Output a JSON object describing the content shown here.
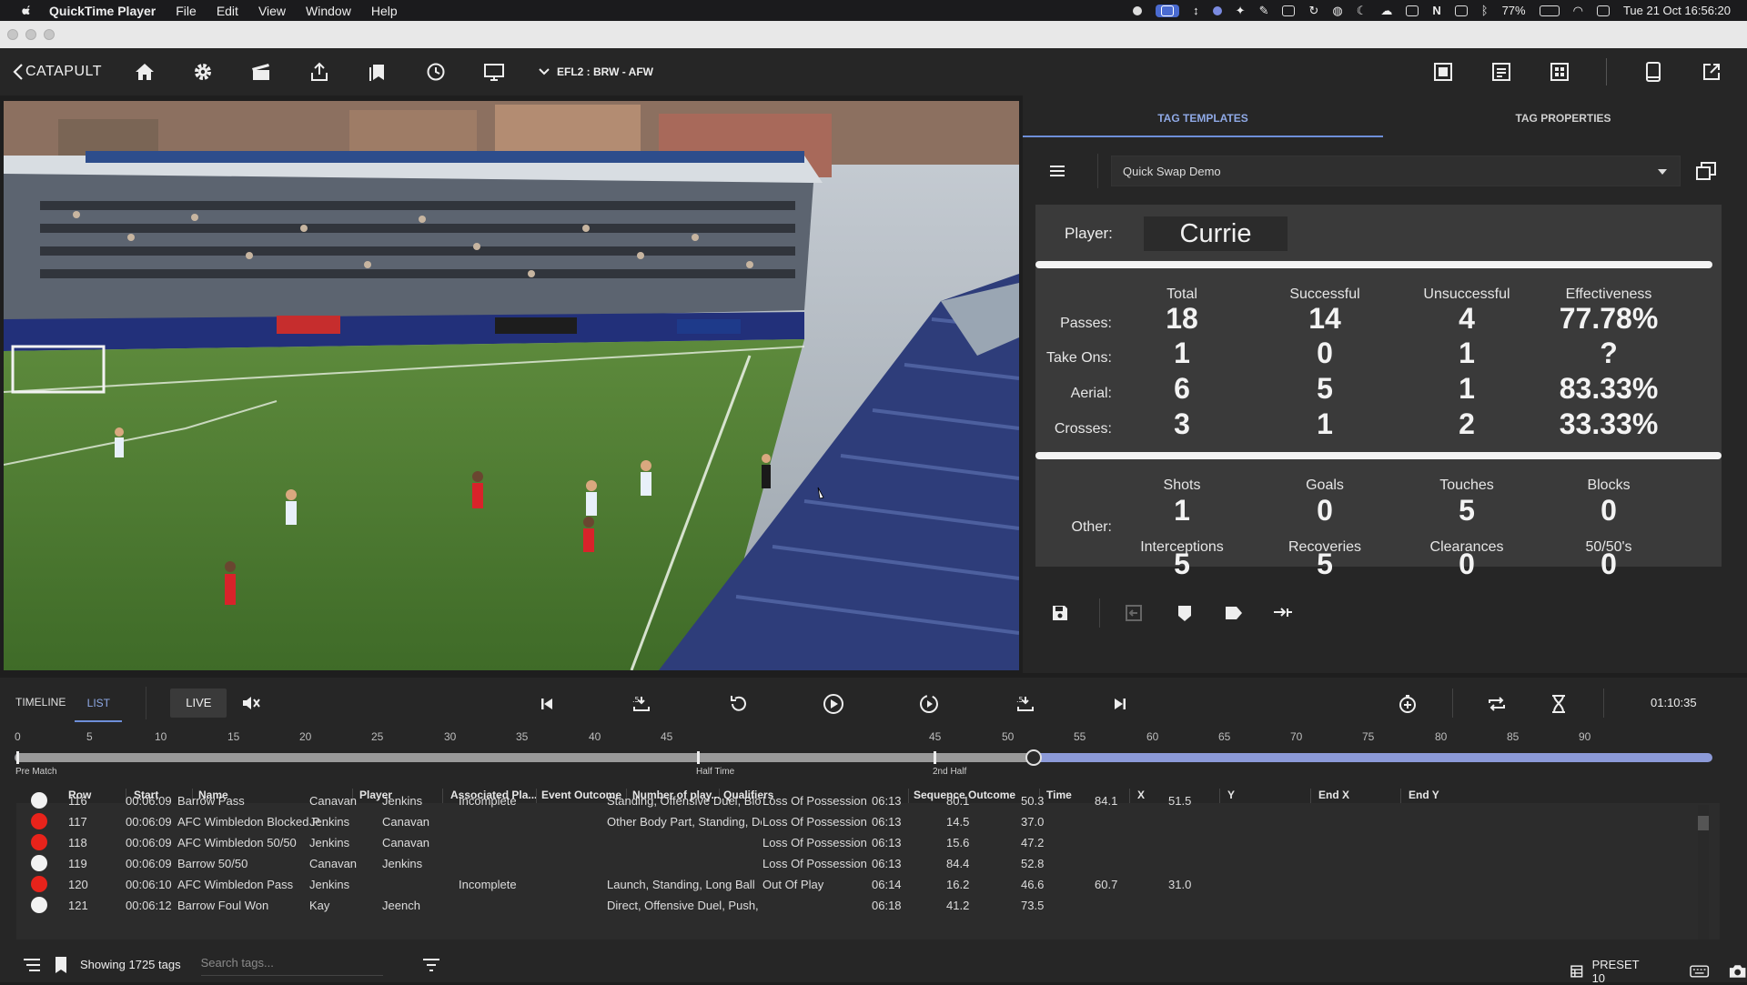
{
  "menubar": {
    "app_name": "QuickTime Player",
    "items": [
      "File",
      "Edit",
      "View",
      "Window",
      "Help"
    ],
    "battery": "77%",
    "datetime": "Tue 21 Oct  16:56:20"
  },
  "toolbar": {
    "brand": "CATAPULT",
    "match_label": "EFL2 : BRW - AFW"
  },
  "panel": {
    "tabs": [
      "TAG TEMPLATES",
      "TAG PROPERTIES"
    ],
    "active_tab": "TAG TEMPLATES",
    "template_value": "Quick Swap Demo",
    "player_label": "Player:",
    "player_name": "Currie",
    "stat_headers": [
      "Total",
      "Successful",
      "Unsuccessful",
      "Effectiveness"
    ],
    "stat_rows": [
      {
        "label": "Passes:",
        "total": "18",
        "successful": "14",
        "unsuccessful": "4",
        "effectiveness": "77.78%"
      },
      {
        "label": "Take Ons:",
        "total": "1",
        "successful": "0",
        "unsuccessful": "1",
        "effectiveness": "?"
      },
      {
        "label": "Aerial:",
        "total": "6",
        "successful": "5",
        "unsuccessful": "1",
        "effectiveness": "83.33%"
      },
      {
        "label": "Crosses:",
        "total": "3",
        "successful": "1",
        "unsuccessful": "2",
        "effectiveness": "33.33%"
      }
    ],
    "other_label": "Other:",
    "other_stats": [
      {
        "label": "Shots",
        "value": "1"
      },
      {
        "label": "Goals",
        "value": "0"
      },
      {
        "label": "Touches",
        "value": "5"
      },
      {
        "label": "Blocks",
        "value": "0"
      },
      {
        "label": "Interceptions",
        "value": "5"
      },
      {
        "label": "Recoveries",
        "value": "5"
      },
      {
        "label": "Clearances",
        "value": "0"
      },
      {
        "label": "50/50's",
        "value": "0"
      }
    ]
  },
  "controls": {
    "view_tabs": [
      "TIMELINE",
      "LIST"
    ],
    "active_view": "LIST",
    "live_label": "LIVE",
    "clock": "01:10:35"
  },
  "timeline": {
    "ticks_first_half": [
      "0",
      "5",
      "10",
      "15",
      "20",
      "25",
      "30",
      "35",
      "40",
      "45"
    ],
    "ticks_second_half": [
      "45",
      "50",
      "55",
      "60",
      "65",
      "70",
      "75",
      "80",
      "85",
      "90"
    ],
    "labels": [
      "Pre Match",
      "Half Time",
      "2nd Half"
    ],
    "progress_fraction": 0.6
  },
  "table": {
    "columns": [
      "Row",
      "Start",
      "Name",
      "Player",
      "Associated Pla...",
      "Event Outcome",
      "Number of play...",
      "Qualifiers",
      "Sequence Outcome",
      "Time",
      "X",
      "Y",
      "End X",
      "End Y"
    ],
    "rows": [
      {
        "color": "#f2f2f2",
        "cells": [
          "116",
          "00:06:09",
          "Barrow Pass",
          "Canavan",
          "Jenkins",
          "Incomplete",
          "",
          "Standing, Offensive Duel, Blocke...",
          "Loss Of Possession",
          "06:13",
          "80.1",
          "50.3",
          "84.1",
          "51.5"
        ]
      },
      {
        "color": "#e8231b",
        "cells": [
          "117",
          "00:06:09",
          "AFC Wimbledon Blocked P...",
          "Jenkins",
          "Canavan",
          "",
          "",
          "Other Body Part, Standing, Defen...",
          "Loss Of Possession",
          "06:13",
          "14.5",
          "37.0",
          "",
          ""
        ]
      },
      {
        "color": "#e8231b",
        "cells": [
          "118",
          "00:06:09",
          "AFC Wimbledon 50/50",
          "Jenkins",
          "Canavan",
          "",
          "",
          "",
          "Loss Of Possession",
          "06:13",
          "15.6",
          "47.2",
          "",
          ""
        ]
      },
      {
        "color": "#f2f2f2",
        "cells": [
          "119",
          "00:06:09",
          "Barrow 50/50",
          "Canavan",
          "Jenkins",
          "",
          "",
          "",
          "Loss Of Possession",
          "06:13",
          "84.4",
          "52.8",
          "",
          ""
        ]
      },
      {
        "color": "#e8231b",
        "cells": [
          "120",
          "00:06:10",
          "AFC Wimbledon Pass",
          "Jenkins",
          "",
          "Incomplete",
          "",
          "Launch, Standing, Long Ball",
          "Out Of Play",
          "06:14",
          "16.2",
          "46.6",
          "60.7",
          "31.0"
        ]
      },
      {
        "color": "#f2f2f2",
        "cells": [
          "121",
          "00:06:12",
          "Barrow Foul Won",
          "Kay",
          "Jeench",
          "",
          "",
          "Direct, Offensive Duel, Push, Foul",
          "",
          "06:18",
          "41.2",
          "73.5",
          "",
          ""
        ]
      }
    ]
  },
  "status": {
    "showing": "Showing 1725 tags",
    "search_placeholder": "Search tags...",
    "preset": "PRESET 10"
  }
}
